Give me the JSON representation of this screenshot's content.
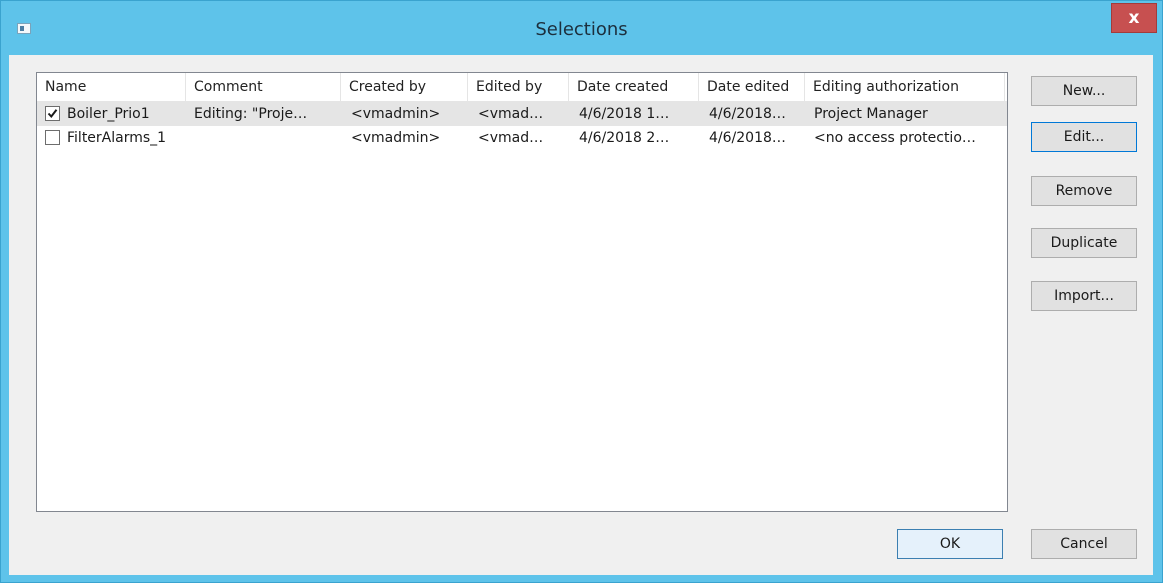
{
  "window": {
    "title": "Selections",
    "close_glyph": "x",
    "icon": "window-app-icon"
  },
  "list": {
    "columns": [
      "Name",
      "Comment",
      "Created by",
      "Edited by",
      "Date created",
      "Date edited",
      "Editing authorization"
    ],
    "rows": [
      {
        "checked": true,
        "name": "Boiler_Prio1",
        "comment": "Editing: \"Proje…",
        "created_by": "<vmadmin>",
        "edited_by": "<vmad…",
        "date_created": "4/6/2018 1…",
        "date_edited": "4/6/2018…",
        "authorization": "Project Manager",
        "selected": true
      },
      {
        "checked": false,
        "name": "FilterAlarms_1",
        "comment": "",
        "created_by": "<vmadmin>",
        "edited_by": "<vmad…",
        "date_created": "4/6/2018 2…",
        "date_edited": "4/6/2018…",
        "authorization": "<no access protectio…",
        "selected": false
      }
    ]
  },
  "buttons": {
    "new": "New...",
    "edit": "Edit...",
    "remove": "Remove",
    "duplicate": "Duplicate",
    "import": "Import...",
    "ok": "OK",
    "cancel": "Cancel"
  },
  "colors": {
    "titlebar": "#5ec3ea",
    "close": "#c75050",
    "client": "#f0f0f0",
    "row_selected": "#e5e5e5"
  }
}
